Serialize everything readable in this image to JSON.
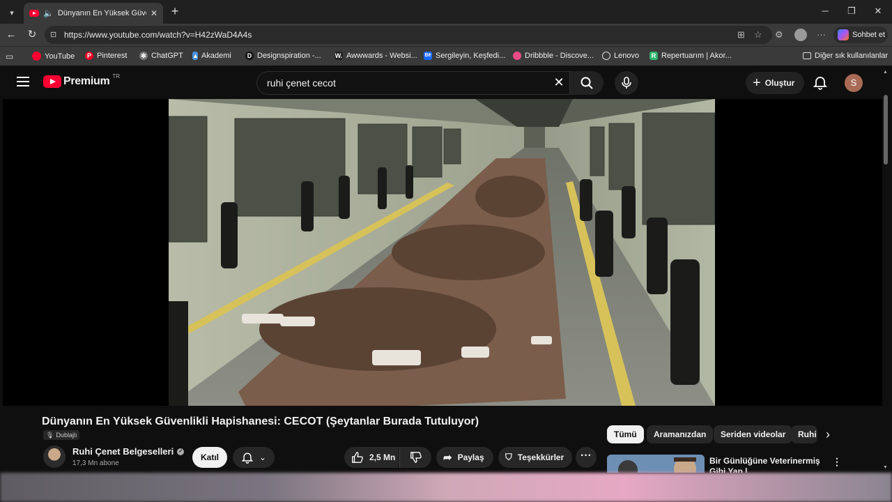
{
  "browser": {
    "tab": {
      "title": "Dünyanın En Yüksek Güvenlikli"
    },
    "url": "https://www.youtube.com/watch?v=H42zWaD4A4s",
    "copilot_label": "Sohbet et",
    "bookmarks": [
      {
        "label": "YouTube",
        "color": "#ff0033"
      },
      {
        "label": "Pinterest",
        "color": "#e60023"
      },
      {
        "label": "ChatGPT",
        "color": "#777777"
      },
      {
        "label": "Akademi",
        "color": "#4a90d9"
      },
      {
        "label": "Designspiration -...",
        "color": "#111111"
      },
      {
        "label": "Awwwards - Websi...",
        "color": "#222222"
      },
      {
        "label": "Sergileyin, Keşfedi...",
        "color": "#1769ff"
      },
      {
        "label": "Dribbble - Discove...",
        "color": "#ea4c89"
      },
      {
        "label": "Lenovo",
        "color": "#555555"
      },
      {
        "label": "Repertuarım | Akor...",
        "color": "#2fb46e"
      }
    ],
    "other_bookmarks": "Diğer sık kullanılanlar"
  },
  "youtube": {
    "logo_text": "Premium",
    "country_code": "TR",
    "search_value": "ruhi çenet cecot",
    "create_label": "Oluştur",
    "avatar_letter": "S",
    "video": {
      "title": "Dünyanın En Yüksek Güvenlikli Hapishanesi: CECOT (Şeytanlar Burada Tutuluyor)",
      "dubbed_badge": "Dublajlı",
      "channel_name": "Ruhi Çenet Belgeselleri",
      "subscribers": "17,3 Mn abone",
      "join_label": "Katıl",
      "likes": "2,5 Mn",
      "share_label": "Paylaş",
      "thanks_label": "Teşekkürler"
    },
    "chips": [
      {
        "label": "Tümü",
        "active": true
      },
      {
        "label": "Aramanızdan",
        "active": false
      },
      {
        "label": "Seriden videolar",
        "active": false
      },
      {
        "label": "Ruhi",
        "active": false
      }
    ],
    "recommendation": {
      "title": "Bir Günlüğüne Veterinermiş Gibi Yap | @DorukDemirelDeBiDe"
    }
  }
}
